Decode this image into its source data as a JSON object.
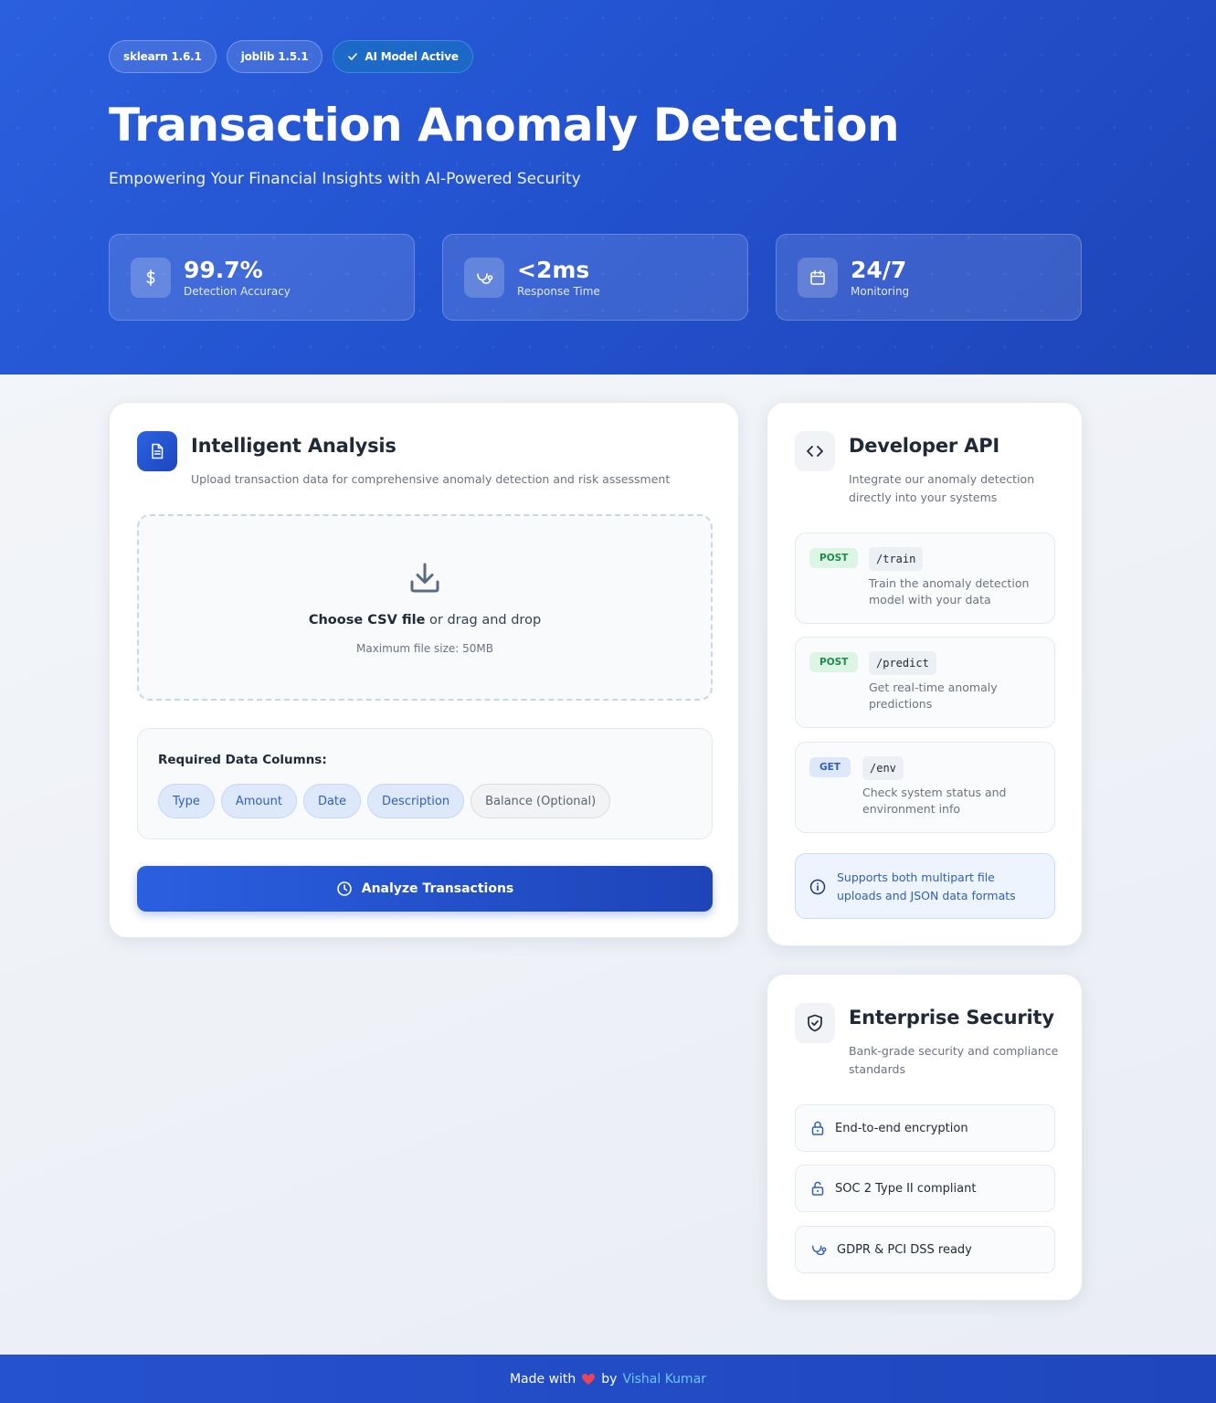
{
  "hero": {
    "badges": [
      {
        "label": "sklearn 1.6.1"
      },
      {
        "label": "joblib 1.5.1"
      },
      {
        "label": "AI Model Active",
        "icon": "check-icon"
      }
    ],
    "title": "Transaction Anomaly Detection",
    "subtitle": "Empowering Your Financial Insights with AI-Powered Security",
    "stats": [
      {
        "value": "99.7%",
        "label": "Detection Accuracy",
        "icon": "dollar-icon"
      },
      {
        "value": "<2ms",
        "label": "Response Time",
        "icon": "stethoscope-icon"
      },
      {
        "value": "24/7",
        "label": "Monitoring",
        "icon": "calendar-icon"
      }
    ]
  },
  "analysis": {
    "title": "Intelligent Analysis",
    "description": "Upload transaction data for comprehensive anomaly detection and risk assessment",
    "dropzone": {
      "choose_label": "Choose CSV file",
      "drag_label": " or drag and drop",
      "hint": "Maximum file size: 50MB"
    },
    "columns": {
      "title": "Required Data Columns:",
      "items": [
        "Type",
        "Amount",
        "Date",
        "Description",
        "Balance (Optional)"
      ]
    },
    "analyze_button": "Analyze Transactions"
  },
  "api": {
    "title": "Developer API",
    "description": "Integrate our anomaly detection directly into your systems",
    "endpoints": [
      {
        "method": "POST",
        "path": "/train",
        "description": "Train the anomaly detection model with your data"
      },
      {
        "method": "POST",
        "path": "/predict",
        "description": "Get real-time anomaly predictions"
      },
      {
        "method": "GET",
        "path": "/env",
        "description": "Check system status and environment info"
      }
    ],
    "note": "Supports both multipart file uploads and JSON data formats"
  },
  "security": {
    "title": "Enterprise Security",
    "description": "Bank-grade security and compliance standards",
    "items": [
      {
        "label": "End-to-end encryption",
        "icon": "lock-icon"
      },
      {
        "label": "SOC 2 Type II compliant",
        "icon": "unlock-icon"
      },
      {
        "label": "GDPR & PCI DSS ready",
        "icon": "stethoscope-icon"
      }
    ]
  },
  "footer": {
    "made_with": "Made with",
    "by": "by",
    "author": "Vishal Kumar"
  },
  "colors": {
    "primary": "#2a5fdd",
    "primary_dark": "#1e45b9",
    "post_green": "#1f8a4c",
    "link_blue": "#6cc6ff",
    "heart": "#e8455a"
  }
}
